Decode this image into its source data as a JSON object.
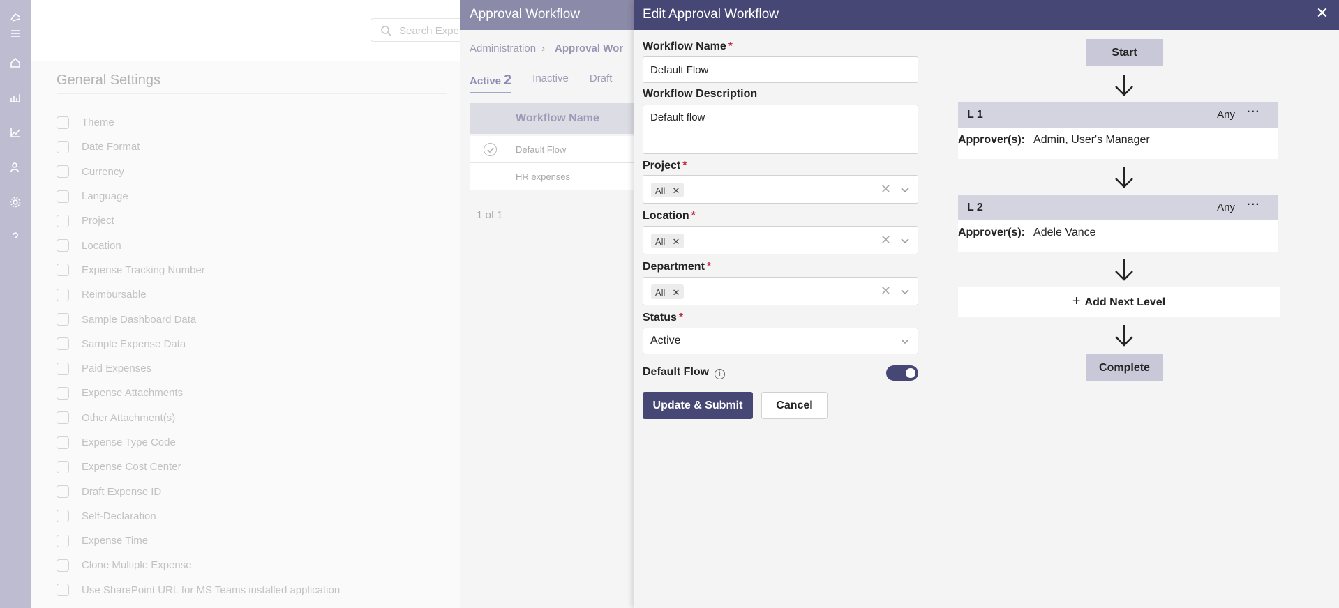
{
  "rail_icons": [
    "app-logo-icon",
    "hamburger-icon",
    "home-icon",
    "dashboard-icon",
    "analytics-icon",
    "users-icon",
    "settings-icon",
    "help-icon"
  ],
  "background": {
    "search_placeholder": "Search Exper",
    "section_title": "General Settings",
    "settings_items": [
      "Theme",
      "Date Format",
      "Currency",
      "Language",
      "Project",
      "Location",
      "Expense Tracking Number",
      "Reimbursable",
      "Sample Dashboard Data",
      "Sample Expense Data",
      "Paid Expenses",
      "Expense Attachments",
      "Other Attachment(s)",
      "Expense Type Code",
      "Expense Cost Center",
      "Draft Expense ID",
      "Self-Declaration",
      "Expense Time",
      "Clone Multiple Expense",
      "Use SharePoint URL for MS Teams installed application"
    ]
  },
  "approval_panel": {
    "title": "Approval Workflow",
    "breadcrumb": {
      "root": "Administration",
      "current": "Approval Wor"
    },
    "tabs": [
      {
        "label": "Active",
        "count": "2"
      },
      {
        "label": "Inactive"
      },
      {
        "label": "Draft"
      }
    ],
    "table": {
      "header": "Workflow Name",
      "rows": [
        "Default Flow",
        "HR expenses"
      ]
    },
    "pager": "1 of 1"
  },
  "edit": {
    "title": "Edit Approval Workflow",
    "close_glyph": "✕",
    "name_label": "Workflow Name",
    "name_value": "Default Flow",
    "desc_label": "Workflow Description",
    "desc_value": "Default flow",
    "project_label": "Project",
    "project_values": [
      "All"
    ],
    "location_label": "Location",
    "location_values": [
      "All"
    ],
    "department_label": "Department",
    "department_values": [
      "All"
    ],
    "status_label": "Status",
    "status_value": "Active",
    "default_flow_label": "Default Flow",
    "default_flow_on": true,
    "required_mark": "*",
    "submit_label": "Update & Submit",
    "cancel_label": "Cancel"
  },
  "flow": {
    "start_label": "Start",
    "levels": [
      {
        "name": "L 1",
        "mode": "Any",
        "approvers_label": "Approver(s):",
        "approvers": "Admin, User's Manager"
      },
      {
        "name": "L 2",
        "mode": "Any",
        "approvers_label": "Approver(s):",
        "approvers": "Adele Vance"
      }
    ],
    "add_level_label": "Add Next Level",
    "complete_label": "Complete"
  },
  "colors": {
    "brand": "#464775",
    "level_header": "#d4d4e1",
    "flow_button": "#c9c8d9",
    "required": "#c4314b"
  }
}
